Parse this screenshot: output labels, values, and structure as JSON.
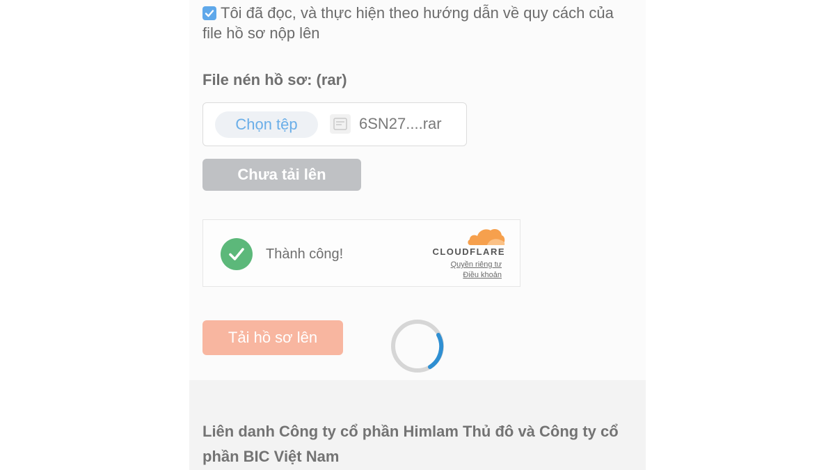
{
  "consent": {
    "checked": true,
    "text": "Tôi đã đọc, và thực hiện theo hướng dẫn về quy cách của file hồ sơ nộp lên"
  },
  "file_upload": {
    "label": "File nén hồ sơ: (rar)",
    "choose_button": "Chọn tệp",
    "file_name": "6SN27....rar"
  },
  "status_button": "Chưa tải lên",
  "captcha": {
    "status": "Thành công!",
    "brand": "CLOUDFLARE",
    "privacy_link": "Quyền riêng tư",
    "terms_link": "Điều khoản"
  },
  "submit_button": "Tải hồ sơ lên",
  "footer": {
    "company": "Liên danh Công ty cổ phần Himlam Thủ đô và Công ty cổ phần BIC Việt Nam"
  },
  "colors": {
    "checkbox": "#5fa8ea",
    "submit": "#f8b6a0",
    "success": "#5cb87a",
    "cloudflare": "#f6a04d",
    "spinner_active": "#2f8fd2"
  }
}
